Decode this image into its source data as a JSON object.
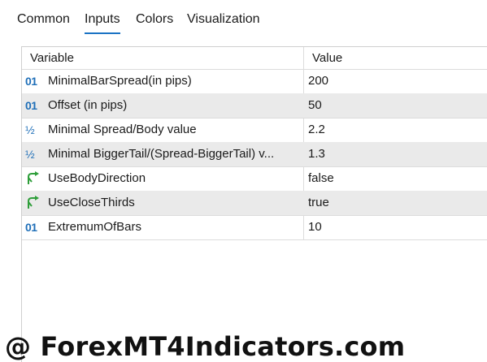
{
  "tabs": [
    {
      "label": "Common"
    },
    {
      "label": "Inputs",
      "active": true
    },
    {
      "label": "Colors"
    },
    {
      "label": "Visualization"
    }
  ],
  "table": {
    "columns": [
      "Variable",
      "Value"
    ],
    "rows": [
      {
        "icon": "integer-icon",
        "name": "MinimalBarSpread(in pips)",
        "value": "200"
      },
      {
        "icon": "integer-icon",
        "name": "Offset (in pips)",
        "value": "50"
      },
      {
        "icon": "fraction-icon",
        "name": "Minimal Spread/Body value",
        "value": "2.2"
      },
      {
        "icon": "fraction-icon",
        "name": "Minimal BiggerTail/(Spread-BiggerTail) v...",
        "value": "1.3"
      },
      {
        "icon": "boolean-icon",
        "name": "UseBodyDirection",
        "value": "false"
      },
      {
        "icon": "boolean-icon",
        "name": "UseCloseThirds",
        "value": "true"
      },
      {
        "icon": "integer-icon",
        "name": "ExtremumOfBars",
        "value": "10"
      }
    ]
  },
  "watermark": "@ ForexMT4Indicators.com",
  "colors": {
    "accent": "#1a72c4",
    "alt_row": "#eaeaea",
    "int_icon": "#1f6fb8",
    "bool_icon": "#2e9e3a"
  }
}
